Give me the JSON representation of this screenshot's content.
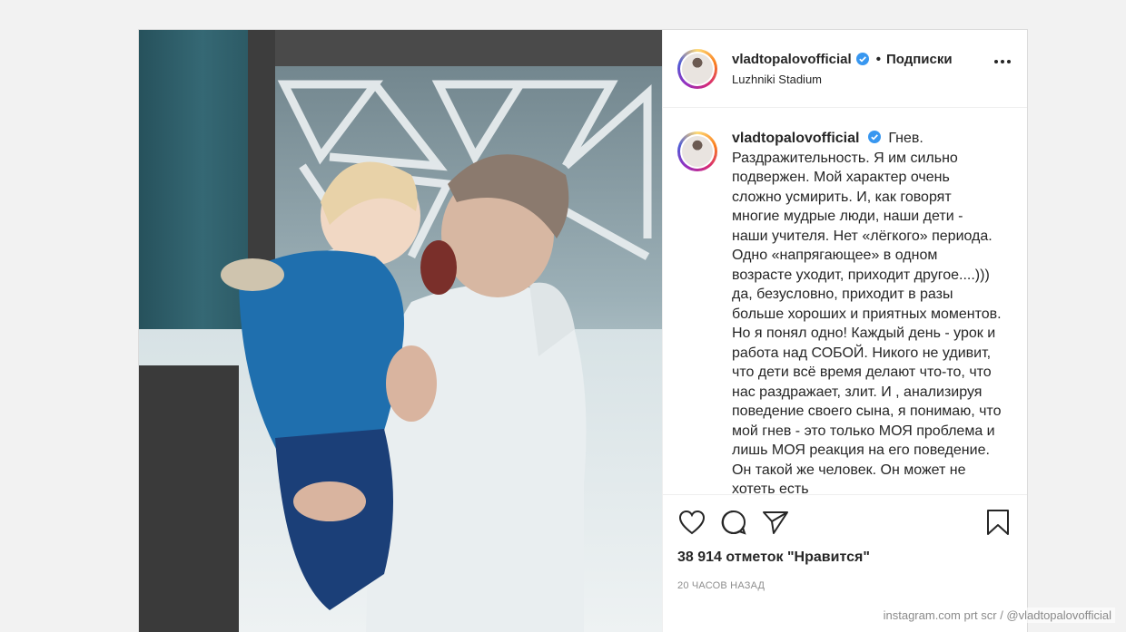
{
  "post": {
    "username": "vladtopalovofficial",
    "follow_label": "Подписки",
    "location": "Luzhniki Stadium",
    "caption_username": "vladtopalovofficial",
    "caption_text": "Гнев. Раздражительность. Я им сильно подвержен. Мой характер очень сложно усмирить. И, как говорят многие мудрые люди, наши дети - наши учителя. Нет «лёгкого» периода. Одно «напрягающее» в одном возрасте уходит, приходит другое....))) да, безусловно, приходит в разы больше хороших и приятных моментов. Но я понял одно! Каждый день - урок и работа над СОБОЙ. Никого не удивит, что дети всё время делают что-то, что нас раздражает, злит. И , анализируя поведение своего сына, я понимаю, что мой гнев - это только МОЯ проблема и лишь МОЯ реакция на его поведение. Он такой же человек. Он может не хотеть есть",
    "likes": "38 914 отметок \"Нравится\"",
    "time": "20 ЧАСОВ НАЗАД"
  },
  "icons": {
    "verified": "verified-badge-icon",
    "more": "more-options-icon",
    "like": "heart-icon",
    "comment": "comment-icon",
    "share": "paper-plane-icon",
    "save": "bookmark-icon"
  },
  "colors": {
    "verified_blue": "#3897f0",
    "border": "#dbdbdb",
    "text": "#262626",
    "muted": "#8e8e8e"
  },
  "credit": "instagram.com  prt scr / @vladtopalovofficial"
}
